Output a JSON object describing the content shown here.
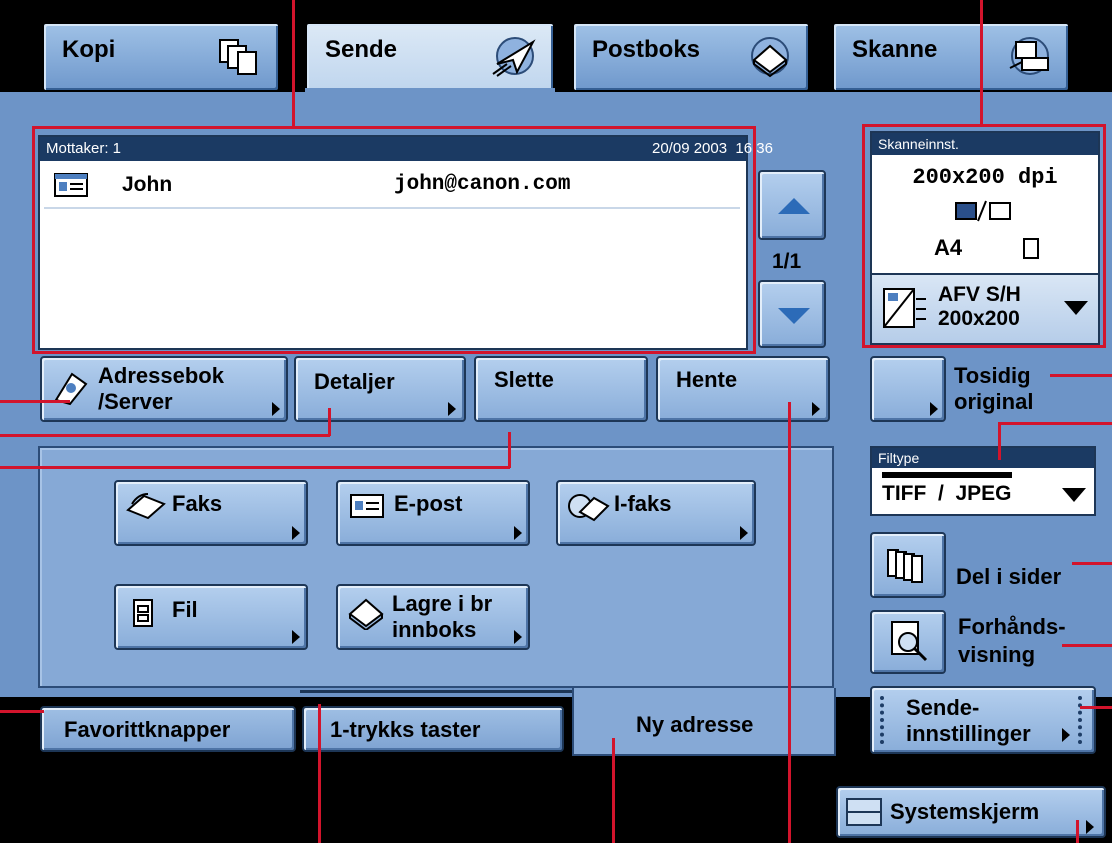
{
  "tabs": {
    "copy": "Kopi",
    "send": "Sende",
    "mailbox": "Postboks",
    "scan": "Skanne"
  },
  "recipients": {
    "header_label": "Mottaker: 1",
    "datetime": "20/09 2003  16:36",
    "rows": [
      {
        "name": "John",
        "email": "john@canon.com"
      }
    ],
    "page": "1/1"
  },
  "scan_settings": {
    "title": "Skanneinnst.",
    "resolution": "200x200 dpi",
    "paper": "A4",
    "mode_line1": "AFV S/H",
    "mode_line2": "200x200"
  },
  "buttons": {
    "addressbook_line1": "Adressebok",
    "addressbook_line2": "/Server",
    "details": "Detaljer",
    "delete": "Slette",
    "fetch": "Hente",
    "fax": "Faks",
    "email": "E-post",
    "ifax": "I-faks",
    "file": "Fil",
    "store_line1": "Lagre i br",
    "store_line2": "innboks",
    "favorites": "Favorittknapper",
    "onetouch": "1-trykks taster",
    "new_address": "Ny adresse",
    "duplex_line1": "Tosidig",
    "duplex_line2": "original",
    "split_pages": "Del i sider",
    "preview_line1": "Forhånds-",
    "preview_line2": "visning",
    "send_settings_line1": "Sende-",
    "send_settings_line2": "innstillinger",
    "system_monitor": "Systemskjerm"
  },
  "filetype": {
    "title": "Filtype",
    "value": "TIFF  /  JPEG"
  },
  "colors": {
    "panel": "#6d94c7",
    "button": "#9fbfe4",
    "callout": "#d2142c"
  }
}
